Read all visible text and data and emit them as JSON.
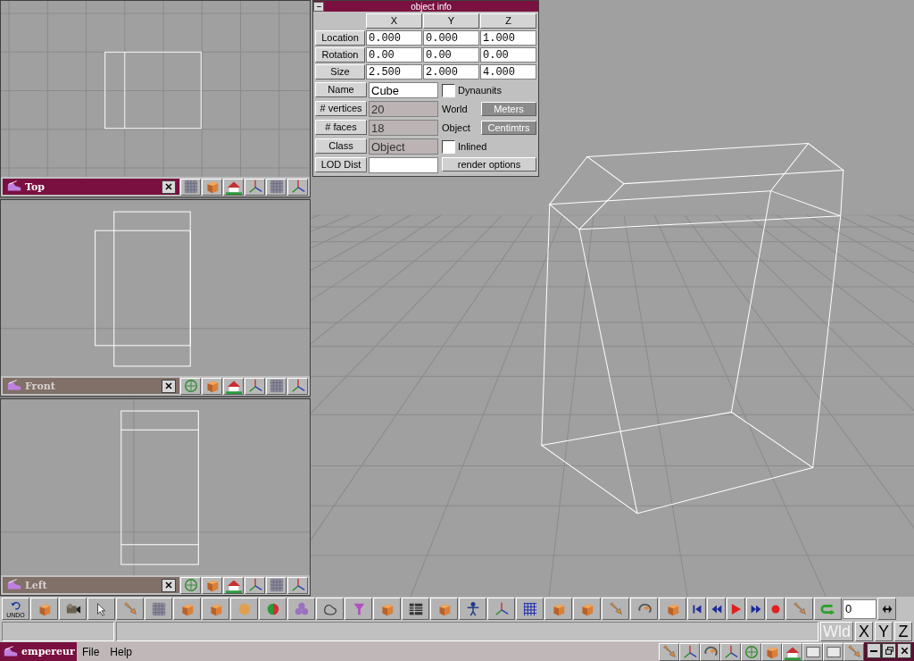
{
  "viewports": [
    {
      "label": "Top",
      "selected": true
    },
    {
      "label": "Front",
      "selected": false
    },
    {
      "label": "Left",
      "selected": false
    }
  ],
  "object_info": {
    "title": "object info",
    "columns": [
      "X",
      "Y",
      "Z"
    ],
    "rows": [
      {
        "label": "Location",
        "values": [
          "0.000",
          "0.000",
          "1.000"
        ]
      },
      {
        "label": "Rotation",
        "values": [
          "0.00",
          "0.00",
          "0.00"
        ]
      },
      {
        "label": "Size",
        "values": [
          "2.500",
          "2.000",
          "4.000"
        ]
      }
    ],
    "fields": [
      {
        "label": "Name",
        "value": "Cube",
        "disabled": false
      },
      {
        "label": "# vertices",
        "value": "20",
        "disabled": true
      },
      {
        "label": "# faces",
        "value": "18",
        "disabled": true
      },
      {
        "label": "Class",
        "value": "Object",
        "disabled": true
      },
      {
        "label": "LOD Dist",
        "disabled": false
      }
    ],
    "dynaunits": {
      "label": "Dynaunits",
      "checked": false
    },
    "units": [
      {
        "label": "World",
        "button": "Meters",
        "disabled": true
      },
      {
        "label": "Object",
        "button": "Centimtrs",
        "disabled": true
      }
    ],
    "inlined": {
      "label": "Inlined",
      "checked": false
    },
    "render_button": "render options"
  },
  "toolbar": {
    "undo_label": "UNDO",
    "frame": "0"
  },
  "coord_buttons": [
    {
      "label": "Wld",
      "disabled": true
    },
    {
      "label": "X",
      "disabled": false
    },
    {
      "label": "Y",
      "disabled": false
    },
    {
      "label": "Z",
      "disabled": false
    }
  ],
  "taskbar": {
    "app": "empereur",
    "menus": [
      "File",
      "Help"
    ]
  }
}
